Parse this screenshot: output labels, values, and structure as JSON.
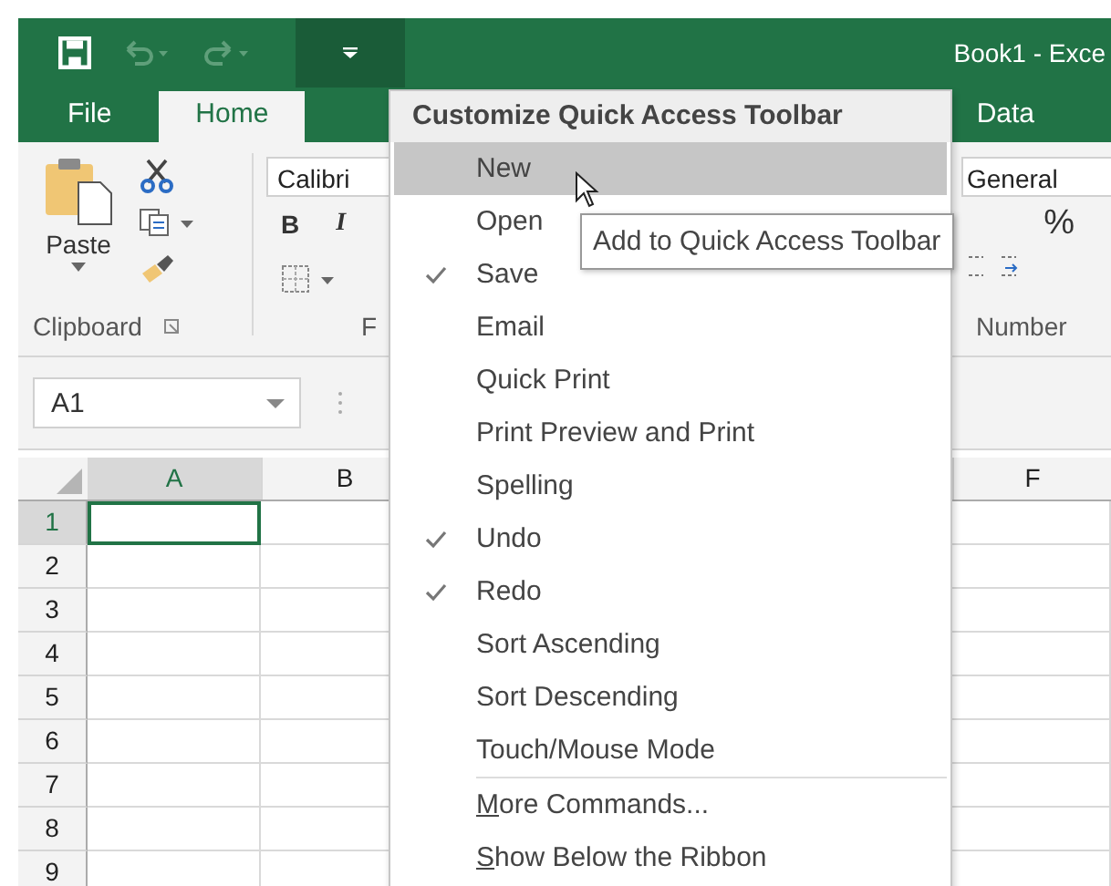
{
  "window": {
    "title": "Book1 - Exce"
  },
  "tabs": [
    {
      "label": "File",
      "selected": false
    },
    {
      "label": "Home",
      "selected": true
    },
    {
      "label": "Data",
      "selected": false
    }
  ],
  "ribbon": {
    "clipboard": {
      "paste_label": "Paste",
      "group_label": "Clipboard"
    },
    "font": {
      "font_name": "Calibri",
      "bold": "B",
      "italic": "I",
      "group_label": "F"
    },
    "number": {
      "format": "General",
      "percent": "%",
      "group_label": "Number"
    }
  },
  "name_box": "A1",
  "columns": [
    {
      "label": "A",
      "selected": true
    },
    {
      "label": "B",
      "selected": false
    },
    {
      "label": "F",
      "selected": false
    }
  ],
  "rows": [
    {
      "label": "1",
      "selected": true
    },
    {
      "label": "2",
      "selected": false
    },
    {
      "label": "3",
      "selected": false
    },
    {
      "label": "4",
      "selected": false
    },
    {
      "label": "5",
      "selected": false
    },
    {
      "label": "6",
      "selected": false
    },
    {
      "label": "7",
      "selected": false
    },
    {
      "label": "8",
      "selected": false
    },
    {
      "label": "9",
      "selected": false
    }
  ],
  "menu": {
    "title": "Customize Quick Access Toolbar",
    "items": [
      {
        "kind": "toggle",
        "label": "New",
        "checked": false,
        "selected": true
      },
      {
        "kind": "toggle",
        "label": "Open",
        "checked": false,
        "selected": false
      },
      {
        "kind": "toggle",
        "label": "Save",
        "checked": true,
        "selected": false
      },
      {
        "kind": "toggle",
        "label": "Email",
        "checked": false,
        "selected": false
      },
      {
        "kind": "toggle",
        "label": "Quick Print",
        "checked": false,
        "selected": false
      },
      {
        "kind": "toggle",
        "label": "Print Preview and Print",
        "checked": false,
        "selected": false
      },
      {
        "kind": "toggle",
        "label": "Spelling",
        "checked": false,
        "selected": false
      },
      {
        "kind": "toggle",
        "label": "Undo",
        "checked": true,
        "selected": false
      },
      {
        "kind": "toggle",
        "label": "Redo",
        "checked": true,
        "selected": false
      },
      {
        "kind": "toggle",
        "label": "Sort Ascending",
        "checked": false,
        "selected": false
      },
      {
        "kind": "toggle",
        "label": "Sort Descending",
        "checked": false,
        "selected": false
      },
      {
        "kind": "toggle",
        "label": "Touch/Mouse Mode",
        "checked": false,
        "selected": false
      },
      {
        "kind": "action",
        "label": "More Commands...",
        "selected": false
      },
      {
        "kind": "action",
        "label": "Show Below the Ribbon",
        "selected": false
      }
    ]
  },
  "tooltip": "Add to Quick Access Toolbar"
}
